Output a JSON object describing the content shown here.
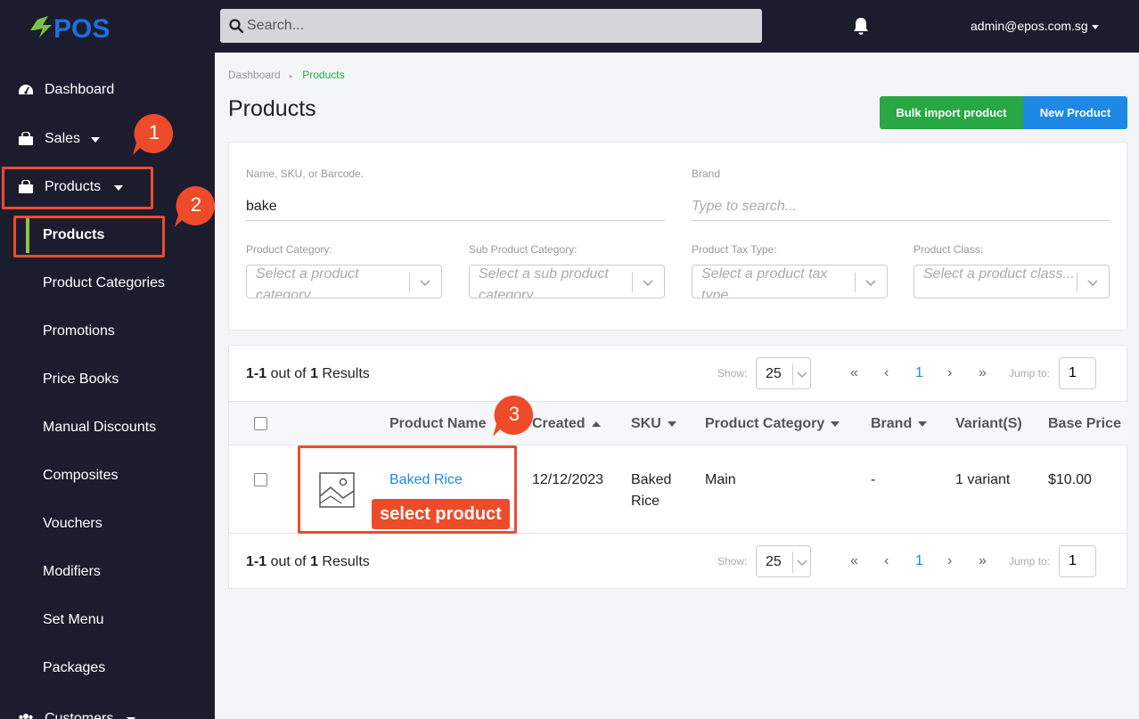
{
  "header": {
    "logo_text": "EPOS",
    "search_placeholder": "Search...",
    "user": "admin@epos.com.sg"
  },
  "sidebar": {
    "items": [
      {
        "label": "Dashboard",
        "icon": "dashboard-icon"
      },
      {
        "label": "Sales",
        "icon": "shopping-bag-icon"
      },
      {
        "label": "Products",
        "icon": "shopping-bag-icon"
      }
    ],
    "sub_items": [
      "Products",
      "Product Categories",
      "Promotions",
      "Price Books",
      "Manual Discounts",
      "Composites",
      "Vouchers",
      "Modifiers",
      "Set Menu",
      "Packages"
    ],
    "customers_label": "Customers"
  },
  "annotations": {
    "badge1": "1",
    "badge2": "2",
    "badge3": "3",
    "select_product": "select product",
    "color": "#ee4b2b"
  },
  "breadcrumb": {
    "parent": "Dashboard",
    "current": "Products"
  },
  "page": {
    "title": "Products",
    "bulk_import": "Bulk import product",
    "new_product": "New Product"
  },
  "filters": {
    "name_label": "Name, SKU, or Barcode.",
    "name_value": "bake",
    "brand_label": "Brand",
    "brand_placeholder": "Type to search...",
    "category_label": "Product Category:",
    "category_placeholder": "Select a product category...",
    "subcategory_label": "Sub Product Category:",
    "subcategory_placeholder": "Select a sub product category...",
    "tax_label": "Product Tax Type:",
    "tax_placeholder": "Select a product tax type...",
    "class_label": "Product Class:",
    "class_placeholder": "Select a product class..."
  },
  "pagination": {
    "range": "1-1",
    "out_of": "out of",
    "total": "1",
    "results": "Results",
    "show_label": "Show:",
    "page_size": "25",
    "first": "«",
    "prev": "‹",
    "current_page": "1",
    "next": "›",
    "last": "»",
    "jump_label": "Jump to:",
    "jump_value": "1"
  },
  "table": {
    "columns": [
      "Product Name",
      "Created",
      "SKU",
      "Product Category",
      "Brand",
      "Variant(S)",
      "Base Price"
    ],
    "rows": [
      {
        "name": "Baked Rice",
        "created": "12/12/2023",
        "sku_line1": "Baked",
        "sku_line2": "Rice",
        "category": "Main",
        "brand": "-",
        "variants": "1 variant",
        "price": "$10.00"
      }
    ]
  }
}
